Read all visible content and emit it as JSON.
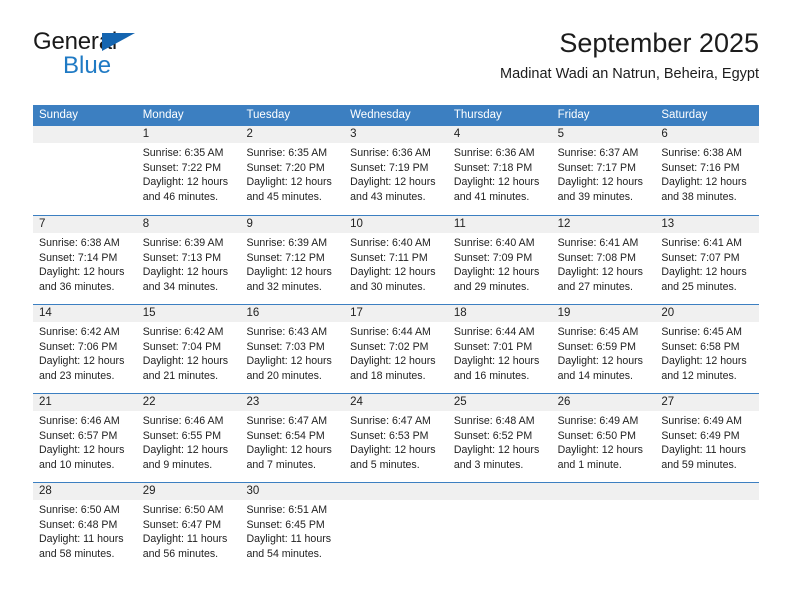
{
  "brand": {
    "word1": "General",
    "word2": "Blue",
    "triangle_color": "#1565b0",
    "word2_color": "#1f7ac4"
  },
  "header": {
    "title": "September 2025",
    "subtitle": "Madinat Wadi an Natrun, Beheira, Egypt"
  },
  "calendar": {
    "header_bg": "#3c7fc1",
    "day_header_bg": "#f0f0f0",
    "weekday_names": [
      "Sunday",
      "Monday",
      "Tuesday",
      "Wednesday",
      "Thursday",
      "Friday",
      "Saturday"
    ],
    "weeks": [
      [
        {
          "day": "",
          "lines": []
        },
        {
          "day": "1",
          "lines": [
            "Sunrise: 6:35 AM",
            "Sunset: 7:22 PM",
            "Daylight: 12 hours",
            "and 46 minutes."
          ]
        },
        {
          "day": "2",
          "lines": [
            "Sunrise: 6:35 AM",
            "Sunset: 7:20 PM",
            "Daylight: 12 hours",
            "and 45 minutes."
          ]
        },
        {
          "day": "3",
          "lines": [
            "Sunrise: 6:36 AM",
            "Sunset: 7:19 PM",
            "Daylight: 12 hours",
            "and 43 minutes."
          ]
        },
        {
          "day": "4",
          "lines": [
            "Sunrise: 6:36 AM",
            "Sunset: 7:18 PM",
            "Daylight: 12 hours",
            "and 41 minutes."
          ]
        },
        {
          "day": "5",
          "lines": [
            "Sunrise: 6:37 AM",
            "Sunset: 7:17 PM",
            "Daylight: 12 hours",
            "and 39 minutes."
          ]
        },
        {
          "day": "6",
          "lines": [
            "Sunrise: 6:38 AM",
            "Sunset: 7:16 PM",
            "Daylight: 12 hours",
            "and 38 minutes."
          ]
        }
      ],
      [
        {
          "day": "7",
          "lines": [
            "Sunrise: 6:38 AM",
            "Sunset: 7:14 PM",
            "Daylight: 12 hours",
            "and 36 minutes."
          ]
        },
        {
          "day": "8",
          "lines": [
            "Sunrise: 6:39 AM",
            "Sunset: 7:13 PM",
            "Daylight: 12 hours",
            "and 34 minutes."
          ]
        },
        {
          "day": "9",
          "lines": [
            "Sunrise: 6:39 AM",
            "Sunset: 7:12 PM",
            "Daylight: 12 hours",
            "and 32 minutes."
          ]
        },
        {
          "day": "10",
          "lines": [
            "Sunrise: 6:40 AM",
            "Sunset: 7:11 PM",
            "Daylight: 12 hours",
            "and 30 minutes."
          ]
        },
        {
          "day": "11",
          "lines": [
            "Sunrise: 6:40 AM",
            "Sunset: 7:09 PM",
            "Daylight: 12 hours",
            "and 29 minutes."
          ]
        },
        {
          "day": "12",
          "lines": [
            "Sunrise: 6:41 AM",
            "Sunset: 7:08 PM",
            "Daylight: 12 hours",
            "and 27 minutes."
          ]
        },
        {
          "day": "13",
          "lines": [
            "Sunrise: 6:41 AM",
            "Sunset: 7:07 PM",
            "Daylight: 12 hours",
            "and 25 minutes."
          ]
        }
      ],
      [
        {
          "day": "14",
          "lines": [
            "Sunrise: 6:42 AM",
            "Sunset: 7:06 PM",
            "Daylight: 12 hours",
            "and 23 minutes."
          ]
        },
        {
          "day": "15",
          "lines": [
            "Sunrise: 6:42 AM",
            "Sunset: 7:04 PM",
            "Daylight: 12 hours",
            "and 21 minutes."
          ]
        },
        {
          "day": "16",
          "lines": [
            "Sunrise: 6:43 AM",
            "Sunset: 7:03 PM",
            "Daylight: 12 hours",
            "and 20 minutes."
          ]
        },
        {
          "day": "17",
          "lines": [
            "Sunrise: 6:44 AM",
            "Sunset: 7:02 PM",
            "Daylight: 12 hours",
            "and 18 minutes."
          ]
        },
        {
          "day": "18",
          "lines": [
            "Sunrise: 6:44 AM",
            "Sunset: 7:01 PM",
            "Daylight: 12 hours",
            "and 16 minutes."
          ]
        },
        {
          "day": "19",
          "lines": [
            "Sunrise: 6:45 AM",
            "Sunset: 6:59 PM",
            "Daylight: 12 hours",
            "and 14 minutes."
          ]
        },
        {
          "day": "20",
          "lines": [
            "Sunrise: 6:45 AM",
            "Sunset: 6:58 PM",
            "Daylight: 12 hours",
            "and 12 minutes."
          ]
        }
      ],
      [
        {
          "day": "21",
          "lines": [
            "Sunrise: 6:46 AM",
            "Sunset: 6:57 PM",
            "Daylight: 12 hours",
            "and 10 minutes."
          ]
        },
        {
          "day": "22",
          "lines": [
            "Sunrise: 6:46 AM",
            "Sunset: 6:55 PM",
            "Daylight: 12 hours",
            "and 9 minutes."
          ]
        },
        {
          "day": "23",
          "lines": [
            "Sunrise: 6:47 AM",
            "Sunset: 6:54 PM",
            "Daylight: 12 hours",
            "and 7 minutes."
          ]
        },
        {
          "day": "24",
          "lines": [
            "Sunrise: 6:47 AM",
            "Sunset: 6:53 PM",
            "Daylight: 12 hours",
            "and 5 minutes."
          ]
        },
        {
          "day": "25",
          "lines": [
            "Sunrise: 6:48 AM",
            "Sunset: 6:52 PM",
            "Daylight: 12 hours",
            "and 3 minutes."
          ]
        },
        {
          "day": "26",
          "lines": [
            "Sunrise: 6:49 AM",
            "Sunset: 6:50 PM",
            "Daylight: 12 hours",
            "and 1 minute."
          ]
        },
        {
          "day": "27",
          "lines": [
            "Sunrise: 6:49 AM",
            "Sunset: 6:49 PM",
            "Daylight: 11 hours",
            "and 59 minutes."
          ]
        }
      ],
      [
        {
          "day": "28",
          "lines": [
            "Sunrise: 6:50 AM",
            "Sunset: 6:48 PM",
            "Daylight: 11 hours",
            "and 58 minutes."
          ]
        },
        {
          "day": "29",
          "lines": [
            "Sunrise: 6:50 AM",
            "Sunset: 6:47 PM",
            "Daylight: 11 hours",
            "and 56 minutes."
          ]
        },
        {
          "day": "30",
          "lines": [
            "Sunrise: 6:51 AM",
            "Sunset: 6:45 PM",
            "Daylight: 11 hours",
            "and 54 minutes."
          ]
        },
        {
          "day": "",
          "lines": []
        },
        {
          "day": "",
          "lines": []
        },
        {
          "day": "",
          "lines": []
        },
        {
          "day": "",
          "lines": []
        }
      ]
    ]
  }
}
